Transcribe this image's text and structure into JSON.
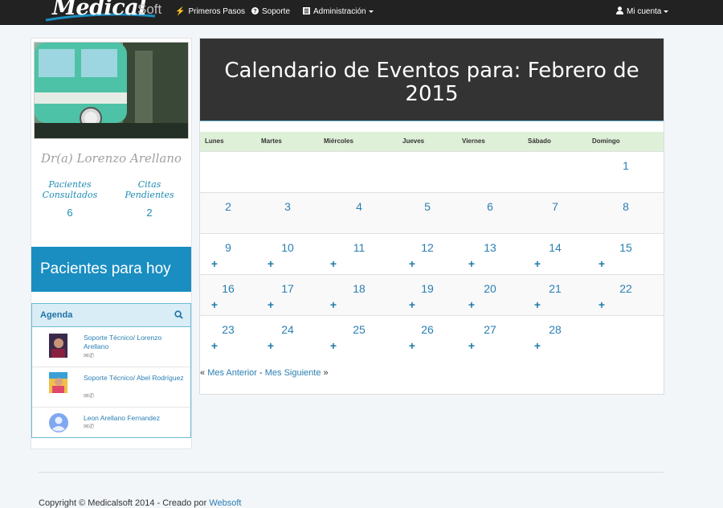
{
  "navbar": {
    "brand_main": "Medical",
    "brand_soft": "Soft",
    "items": [
      {
        "label": "Primeros Pasos",
        "icon": "bolt-icon"
      },
      {
        "label": "Soporte",
        "icon": "question-circle-icon"
      },
      {
        "label": "Administración",
        "icon": "list-icon"
      }
    ],
    "account": {
      "label": "Mi cuenta",
      "icon": "user-icon"
    }
  },
  "sidebar": {
    "doctor_name": "Dr(a) Lorenzo Arellano",
    "stats": [
      {
        "label_1": "Pacientes",
        "label_2": "Consultados",
        "value": "6"
      },
      {
        "label_1": "Citas",
        "label_2": "Pendientes",
        "value": "2"
      }
    ],
    "today_title": "Pacientes para hoy",
    "agenda": {
      "title": "Agenda",
      "items": [
        {
          "text": "Soporte Técnico/ Lorenzo Arellano"
        },
        {
          "text": "Soporte Técnico/ Abel Rodríguez"
        },
        {
          "text": "Leon Arellano Fernandez"
        }
      ]
    }
  },
  "calendar": {
    "title": "Calendario de Eventos para: Febrero de 2015",
    "weekdays": [
      "Lunes",
      "Martes",
      "Miércoles",
      "Jueves",
      "Viernes",
      "Sábado",
      "Domingo"
    ],
    "weeks": [
      [
        "",
        "",
        "",
        "",
        "",
        "",
        "1"
      ],
      [
        "2",
        "3",
        "4",
        "5",
        "6",
        "7",
        "8"
      ],
      [
        "9",
        "10",
        "11",
        "12",
        "13",
        "14",
        "15"
      ],
      [
        "16",
        "17",
        "18",
        "19",
        "20",
        "21",
        "22"
      ],
      [
        "23",
        "24",
        "25",
        "26",
        "27",
        "28",
        ""
      ]
    ],
    "pager": {
      "prev": "Mes Anterior",
      "sep": "-",
      "next": "Mes Siguiente"
    }
  },
  "footer": {
    "text": "Copyright © Medicalsoft 2014 - Creado por",
    "link": "Websoft"
  },
  "colors": {
    "accent": "#1a8ec1",
    "link": "#2a7fb3",
    "header_bg": "#333333",
    "weekday_bg": "#dff0d8"
  }
}
